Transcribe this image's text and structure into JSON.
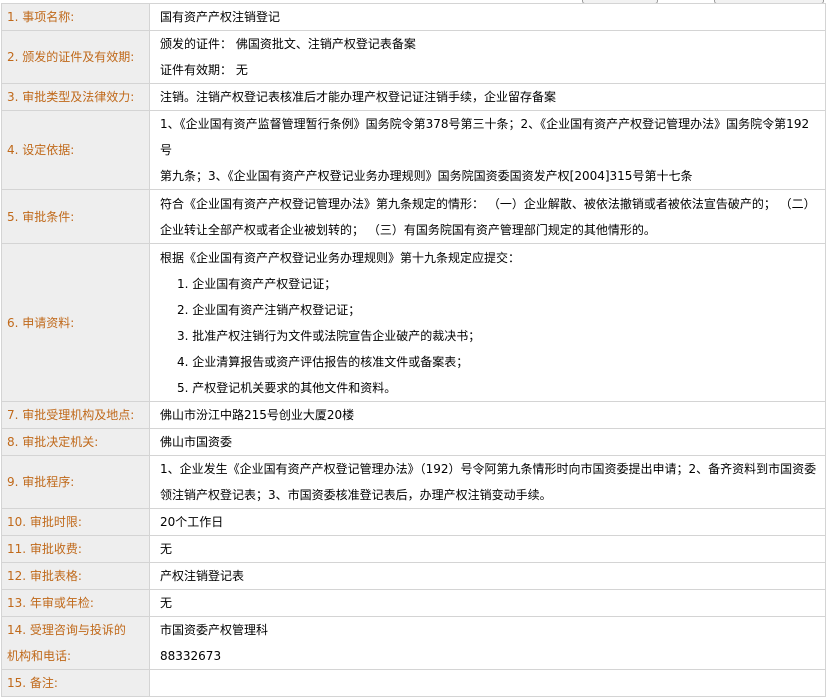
{
  "rows": [
    {
      "label": "1. 事项名称:",
      "lines": [
        "国有资产产权注销登记"
      ]
    },
    {
      "label": "2. 颁发的证件及有效期:",
      "lines": [
        "颁发的证件：  佛国资批文、注销产权登记表备案",
        "证件有效期：  无"
      ]
    },
    {
      "label": "3. 审批类型及法律效力:",
      "lines": [
        "注销。注销产权登记表核准后才能办理产权登记证注销手续，企业留存备案"
      ]
    },
    {
      "label": "4. 设定依据:",
      "lines": [
        "1、《企业国有资产监督管理暂行条例》国务院令第378号第三十条；2、《企业国有资产产权登记管理办法》国务院令第192号",
        "第九条；3、《企业国有资产产权登记业务办理规则》国务院国资委国资发产权[2004]315号第十七条"
      ]
    },
    {
      "label": "5. 审批条件:",
      "lines": [
        "符合《企业国有资产产权登记管理办法》第九条规定的情形：  （一）企业解散、被依法撤销或者被依法宣告破产的；  （二）",
        "企业转让全部产权或者企业被划转的；  （三）有国务院国有资产管理部门规定的其他情形的。"
      ]
    },
    {
      "label": "6. 申请资料:",
      "lines": [
        "根据《企业国有资产产权登记业务办理规则》第十九条规定应提交："
      ],
      "items": [
        "1. 企业国有资产产权登记证；",
        "2. 企业国有资产注销产权登记证；",
        "3. 批准产权注销行为文件或法院宣告企业破产的裁决书；",
        "4. 企业清算报告或资产评估报告的核准文件或备案表；",
        "5. 产权登记机关要求的其他文件和资料。"
      ]
    },
    {
      "label": "7. 审批受理机构及地点:",
      "lines": [
        "佛山市汾江中路215号创业大厦20楼"
      ]
    },
    {
      "label": "8. 审批决定机关:",
      "lines": [
        "佛山市国资委"
      ]
    },
    {
      "label": "9. 审批程序:",
      "lines": [
        "1、企业发生《企业国有资产产权登记管理办法》（192）号令阿第九条情形时向市国资委提出申请；2、备齐资料到市国资委",
        "领注销产权登记表；3、市国资委核准登记表后，办理产权注销变动手续。"
      ]
    },
    {
      "label": "10. 审批时限:",
      "lines": [
        "20个工作日"
      ]
    },
    {
      "label": "11. 审批收费:",
      "lines": [
        "无"
      ]
    },
    {
      "label": "12. 审批表格:",
      "lines": [
        "产权注销登记表"
      ]
    },
    {
      "label": "13. 年审或年检:",
      "lines": [
        "无"
      ]
    },
    {
      "label": "14. 受理咨询与投诉的",
      "label2": "机构和电话:",
      "lines": [
        "市国资委产权管理科",
        "88332673"
      ]
    },
    {
      "label": "15. 备注:",
      "lines": [
        ""
      ]
    }
  ],
  "colors": {
    "label_text": "#c0691a",
    "label_bg": "#eeeeee",
    "border": "#d4d4d4"
  }
}
